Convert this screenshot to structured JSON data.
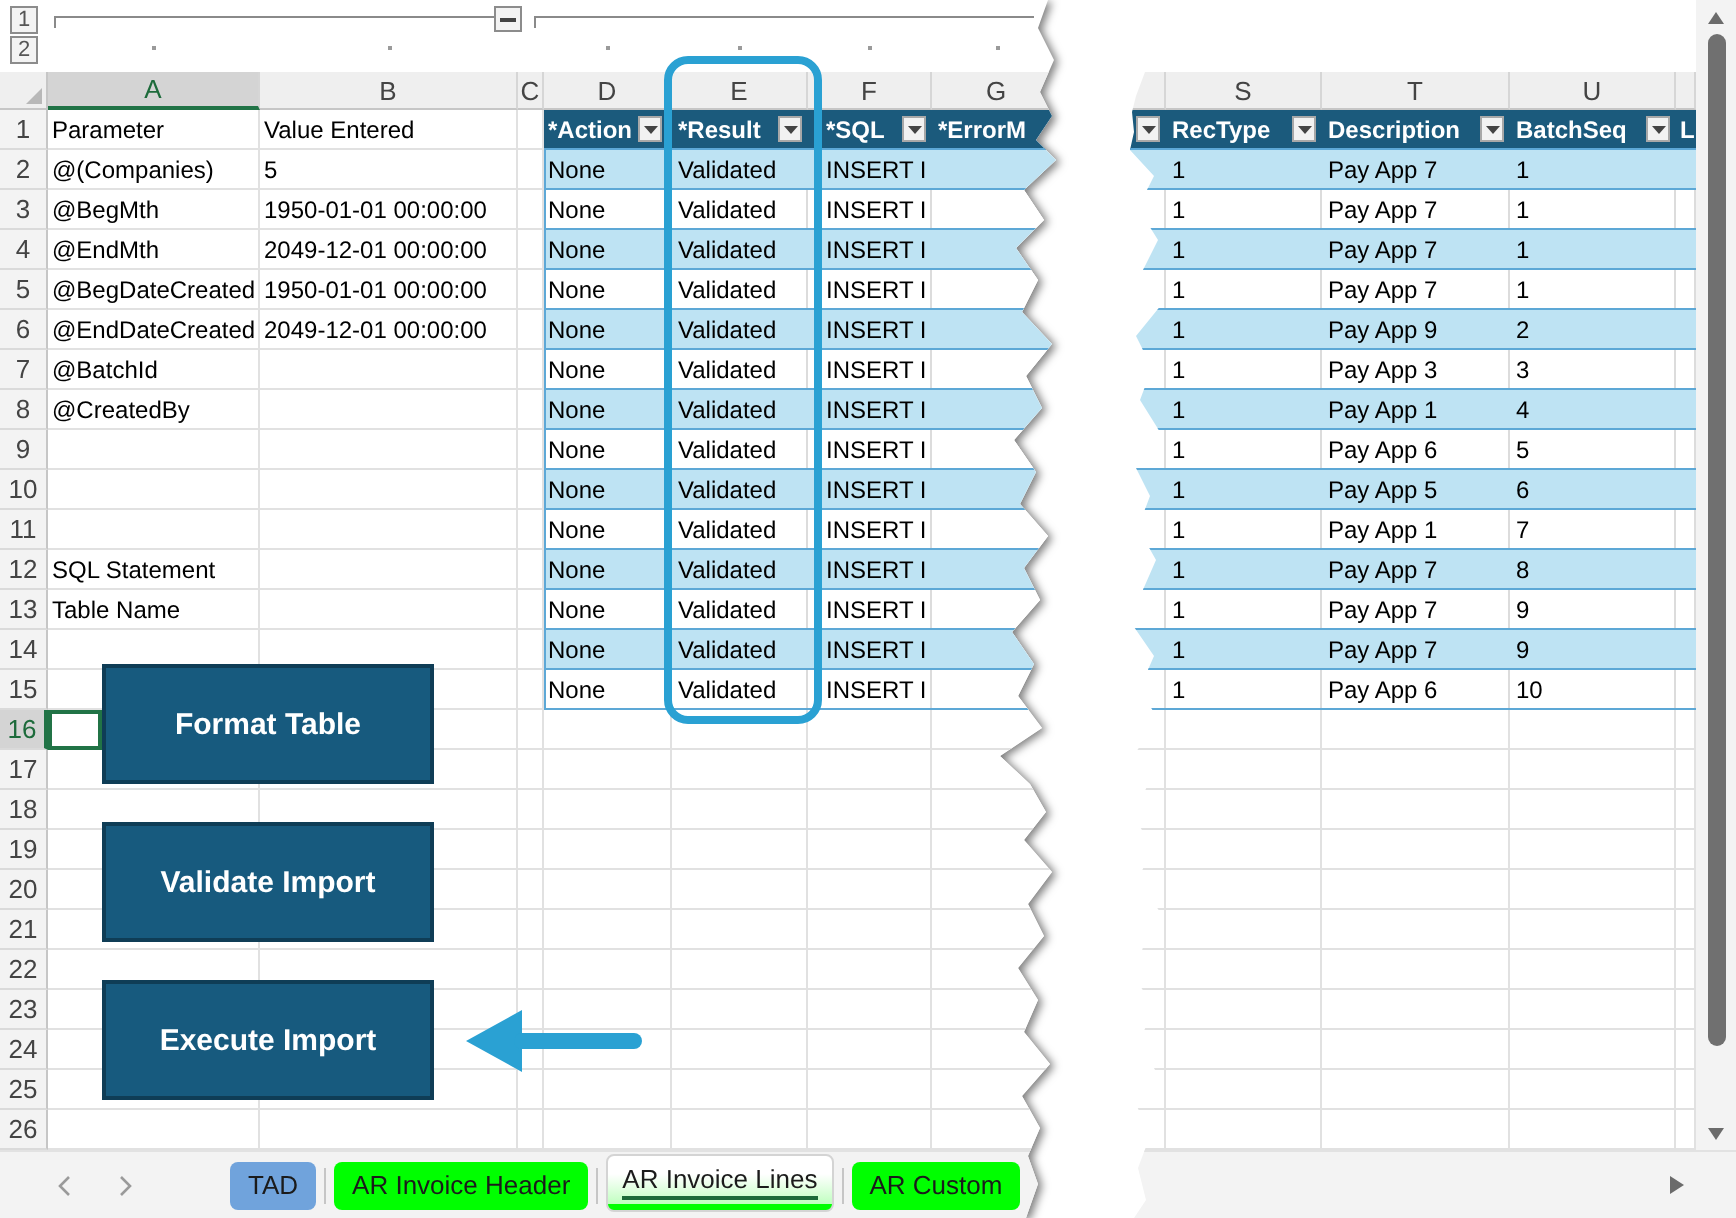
{
  "outline": {
    "levels": [
      "1",
      "2"
    ]
  },
  "sheet": {
    "columns": [
      {
        "letter": "A",
        "selected": true
      },
      {
        "letter": "B",
        "selected": false
      },
      {
        "letter": "C",
        "selected": false
      },
      {
        "letter": "D",
        "selected": false
      },
      {
        "letter": "E",
        "selected": false
      },
      {
        "letter": "F",
        "selected": false
      },
      {
        "letter": "G",
        "selected": false
      }
    ],
    "rows": [
      {
        "number": "1",
        "selected": false
      },
      {
        "number": "2",
        "selected": false
      },
      {
        "number": "3",
        "selected": false
      },
      {
        "number": "4",
        "selected": false
      },
      {
        "number": "5",
        "selected": false
      },
      {
        "number": "6",
        "selected": false
      },
      {
        "number": "7",
        "selected": false
      },
      {
        "number": "8",
        "selected": false
      },
      {
        "number": "9",
        "selected": false
      },
      {
        "number": "10",
        "selected": false
      },
      {
        "number": "11",
        "selected": false
      },
      {
        "number": "12",
        "selected": false
      },
      {
        "number": "13",
        "selected": false
      },
      {
        "number": "14",
        "selected": false
      },
      {
        "number": "15",
        "selected": false
      },
      {
        "number": "16",
        "selected": true
      },
      {
        "number": "17",
        "selected": false
      },
      {
        "number": "18",
        "selected": false
      },
      {
        "number": "19",
        "selected": false
      },
      {
        "number": "20",
        "selected": false
      },
      {
        "number": "21",
        "selected": false
      },
      {
        "number": "22",
        "selected": false
      },
      {
        "number": "23",
        "selected": false
      },
      {
        "number": "24",
        "selected": false
      },
      {
        "number": "25",
        "selected": false
      },
      {
        "number": "26",
        "selected": false
      }
    ],
    "parameters": {
      "header": [
        "Parameter",
        "Value Entered"
      ],
      "rows": [
        [
          "@(Companies)",
          "5"
        ],
        [
          "@BegMth",
          "1950-01-01 00:00:00"
        ],
        [
          "@EndMth",
          "2049-12-01 00:00:00"
        ],
        [
          "@BegDateCreated",
          "1950-01-01 00:00:00"
        ],
        [
          "@EndDateCreated",
          "2049-12-01 00:00:00"
        ],
        [
          "@BatchId"
        ],
        [
          "@CreatedBy"
        ]
      ]
    },
    "labels": [
      "SQL Statement",
      "Table Name"
    ],
    "import_table": {
      "columns": [
        {
          "label": "*Action",
          "filter": true,
          "highlighted": false
        },
        {
          "label": "*Result",
          "filter": true,
          "highlighted": true
        },
        {
          "label": "*SQL",
          "filter": true,
          "highlighted": false
        },
        {
          "label": "*ErrorM",
          "filter": false,
          "highlighted": false
        }
      ],
      "rows": [
        [
          "None",
          "Validated",
          "INSERT I"
        ],
        [
          "None",
          "Validated",
          "INSERT I"
        ],
        [
          "None",
          "Validated",
          "INSERT I"
        ],
        [
          "None",
          "Validated",
          "INSERT I"
        ],
        [
          "None",
          "Validated",
          "INSERT I"
        ],
        [
          "None",
          "Validated",
          "INSERT I"
        ],
        [
          "None",
          "Validated",
          "INSERT I"
        ],
        [
          "None",
          "Validated",
          "INSERT I"
        ],
        [
          "None",
          "Validated",
          "INSERT I"
        ],
        [
          "None",
          "Validated",
          "INSERT I"
        ],
        [
          "None",
          "Validated",
          "INSERT I"
        ],
        [
          "None",
          "Validated",
          "INSERT I"
        ],
        [
          "None",
          "Validated",
          "INSERT I"
        ],
        [
          "None",
          "Validated",
          "INSERT I"
        ]
      ]
    },
    "buttons": [
      {
        "label": "Format Table",
        "pointed": false
      },
      {
        "label": "Validate Import",
        "pointed": false
      },
      {
        "label": "Execute Import",
        "pointed": true
      }
    ]
  },
  "right_sheet": {
    "columns": [
      "S",
      "T",
      "U"
    ],
    "table": {
      "columns": [
        {
          "filter": true
        },
        {
          "label": "RecType",
          "filter": true
        },
        {
          "label": "Description",
          "filter": true
        },
        {
          "label": "BatchSeq",
          "filter": true
        },
        {
          "label": "L",
          "filter": false
        }
      ],
      "rows": [
        [
          "",
          "1",
          "Pay App 7",
          "1"
        ],
        [
          "",
          "1",
          "Pay App 7",
          "1"
        ],
        [
          "",
          "1",
          "Pay App 7",
          "1"
        ],
        [
          "",
          "1",
          "Pay App 7",
          "1"
        ],
        [
          "",
          "1",
          "Pay App 9",
          "2"
        ],
        [
          "",
          "1",
          "Pay App 3",
          "3"
        ],
        [
          "",
          "1",
          "Pay App 1",
          "4"
        ],
        [
          "",
          "1",
          "Pay App 6",
          "5"
        ],
        [
          "",
          "1",
          "Pay App 5",
          "6"
        ],
        [
          "",
          "1",
          "Pay App 1",
          "7"
        ],
        [
          "",
          "1",
          "Pay App 7",
          "8"
        ],
        [
          "",
          "1",
          "Pay App 7",
          "9"
        ],
        [
          "",
          "1",
          "Pay App 7",
          "9"
        ],
        [
          "",
          "1",
          "Pay App 6",
          "10"
        ]
      ]
    }
  },
  "sheet_tabs": [
    {
      "label": "TAD",
      "color": "#70a3dc",
      "selected": false
    },
    {
      "label": "AR Invoice Header",
      "color": "#00ff00",
      "selected": false
    },
    {
      "label": "AR Invoice Lines",
      "color": "#00ff00",
      "selected": true
    },
    {
      "label": "AR Custom",
      "color": "#00ff00",
      "selected": false
    }
  ]
}
